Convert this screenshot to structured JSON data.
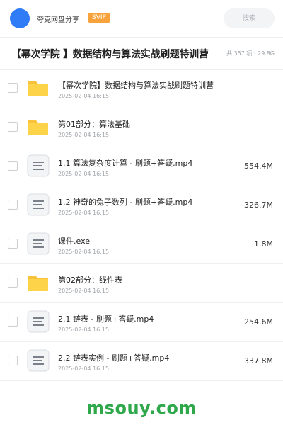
{
  "header": {
    "username": "夸克网盘分享",
    "badge": "SVIP",
    "search_placeholder": "搜索",
    "accent": "#2f7cf6",
    "badge_color": "#f7a23a"
  },
  "folder": {
    "title": "【幂次学院 】数据结构与算法实战刷题特训营",
    "summary": "共 357 项 · 29.8G"
  },
  "files": [
    {
      "type": "folder",
      "icon": "folder-icon",
      "name": "【幂次学院】数据结构与算法实战刷题特训营",
      "date": "2025-02-04 16:15",
      "size": ""
    },
    {
      "type": "folder",
      "icon": "folder-icon",
      "name": "第01部分：算法基础",
      "date": "2025-02-04 16:15",
      "size": ""
    },
    {
      "type": "file",
      "icon": "document-icon",
      "name": "1.1 算法复杂度计算 - 刷题+答疑.mp4",
      "date": "2025-02-04 16:15",
      "size": "554.4M"
    },
    {
      "type": "file",
      "icon": "document-icon",
      "name": "1.2 神奇的兔子数列 - 刷题+答疑.mp4",
      "date": "2025-02-04 16:15",
      "size": "326.7M"
    },
    {
      "type": "file",
      "icon": "document-icon",
      "name": "课件.exe",
      "date": "2025-02-04 16:15",
      "size": "1.8M"
    },
    {
      "type": "folder",
      "icon": "folder-icon",
      "name": "第02部分：线性表",
      "date": "2025-02-04 16:15",
      "size": ""
    },
    {
      "type": "file",
      "icon": "document-icon",
      "name": "2.1 链表 - 刷题+答疑.mp4",
      "date": "2025-02-04 16:15",
      "size": "254.6M"
    },
    {
      "type": "file",
      "icon": "document-icon",
      "name": "2.2 链表实例 - 刷题+答疑.mp4",
      "date": "2025-02-04 16:15",
      "size": "337.8M"
    }
  ],
  "watermark": {
    "text": "msouy.com",
    "color": "#2ea84a"
  }
}
